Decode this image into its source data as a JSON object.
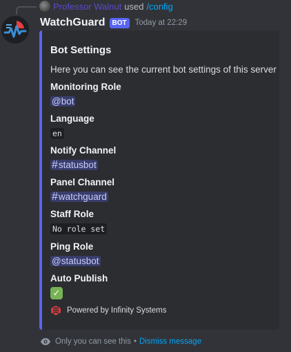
{
  "reply": {
    "user": "Professor Walnut",
    "used_text": "used",
    "command": "/config"
  },
  "message": {
    "author": "WatchGuard",
    "bot_tag": "BOT",
    "timestamp": "Today at 22:29"
  },
  "embed": {
    "accent_color": "#5865f2",
    "title": "Bot Settings",
    "description": "Here you can see the current bot settings of this server",
    "fields": {
      "monitoring_role": {
        "name": "Monitoring Role",
        "value": "@bot"
      },
      "language": {
        "name": "Language",
        "value": "en"
      },
      "notify_channel": {
        "name": "Notify Channel",
        "value": "statusbot"
      },
      "panel_channel": {
        "name": "Panel Channel",
        "value": "watchguard"
      },
      "staff_role": {
        "name": "Staff Role",
        "value": "No role set"
      },
      "ping_role": {
        "name": "Ping Role",
        "value": "@statusbot"
      },
      "auto_publish": {
        "name": "Auto Publish",
        "value": "✓"
      }
    },
    "footer_text": "Powered by Infinity Systems"
  },
  "ephemeral": {
    "notice": "Only you can see this",
    "separator": "•",
    "dismiss_label": "Dismiss message"
  },
  "icons": {
    "channel_hash": "#",
    "eye": "eye-icon",
    "footer": "infinity-systems-logo-icon",
    "avatar": "watchguard-heartbeat-icon"
  }
}
